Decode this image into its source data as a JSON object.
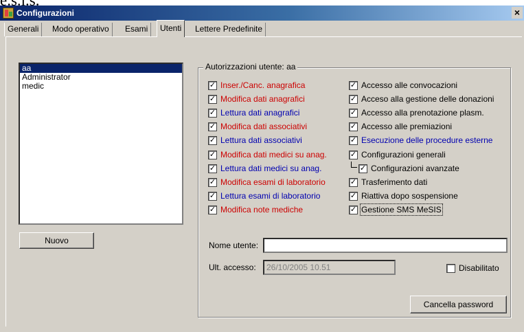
{
  "fragment_text": "e.s.i.s.",
  "window": {
    "title": "Configurazioni",
    "close_glyph": "×"
  },
  "tabs": [
    {
      "label": "Generali",
      "active": false
    },
    {
      "label": "Modo operativo",
      "active": false
    },
    {
      "label": "Esami",
      "active": false
    },
    {
      "label": "Utenti",
      "active": true
    },
    {
      "label": "Lettere Predefinite",
      "active": false
    }
  ],
  "users": {
    "items": [
      "aa",
      "Administrator",
      "medic"
    ],
    "selected": "aa",
    "new_button": "Nuovo"
  },
  "permissions": {
    "group_title": "Autorizzazioni utente: aa",
    "left": [
      {
        "label": "Inser./Canc. anagrafica",
        "checked": true,
        "color": "#cc0000"
      },
      {
        "label": "Modifica dati anagrafici",
        "checked": true,
        "color": "#cc0000"
      },
      {
        "label": "Lettura dati anagrafici",
        "checked": true,
        "color": "#0000b0"
      },
      {
        "label": "Modifica dati associativi",
        "checked": true,
        "color": "#cc0000"
      },
      {
        "label": "Lettura dati associativi",
        "checked": true,
        "color": "#0000b0"
      },
      {
        "label": "Modifica dati medici su anag.",
        "checked": true,
        "color": "#cc0000"
      },
      {
        "label": "Lettura dati medici su anag.",
        "checked": true,
        "color": "#0000b0"
      },
      {
        "label": "Modifica esami di laboratorio",
        "checked": true,
        "color": "#cc0000"
      },
      {
        "label": "Lettura esami di laboratorio",
        "checked": true,
        "color": "#0000b0"
      },
      {
        "label": "Modifica note mediche",
        "checked": true,
        "color": "#cc0000"
      }
    ],
    "right": [
      {
        "label": "Accesso alle convocazioni",
        "checked": true,
        "color": "#000000"
      },
      {
        "label": "Acceso alla gestione delle donazioni",
        "checked": true,
        "color": "#000000"
      },
      {
        "label": "Accesso alla prenotazione plasm.",
        "checked": true,
        "color": "#000000"
      },
      {
        "label": "Accesso alle premiazioni",
        "checked": true,
        "color": "#000000"
      },
      {
        "label": "Esecuzione delle procedure esterne",
        "checked": true,
        "color": "#0000b0"
      },
      {
        "label": "Configurazioni generali",
        "checked": true,
        "color": "#000000"
      },
      {
        "label": "Configurazioni avanzate",
        "checked": true,
        "color": "#000000"
      },
      {
        "label": "Trasferimento dati",
        "checked": true,
        "color": "#000000"
      },
      {
        "label": "Riattiva dopo sospensione",
        "checked": true,
        "color": "#000000"
      },
      {
        "label": "Gestione SMS MeSIS",
        "checked": true,
        "color": "#000000"
      }
    ]
  },
  "form": {
    "username_label": "Nome utente:",
    "username_value": "",
    "last_access_label": "Ult. accesso:",
    "last_access_value": "26/10/2005 10.51",
    "disabled_label": "Disabilitato",
    "disabled_checked": false,
    "reset_password_button": "Cancella password"
  },
  "check_glyph": "✓"
}
